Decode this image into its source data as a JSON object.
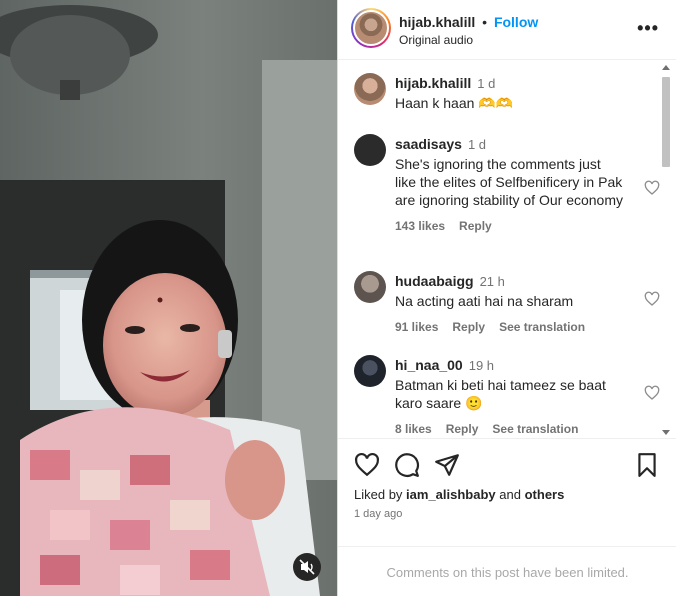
{
  "post": {
    "username": "hijab.khalill",
    "separator": "•",
    "follow_label": "Follow",
    "audio_label": "Original audio",
    "more_label": "•••"
  },
  "comments": [
    {
      "username": "hijab.khalill",
      "time": "1 d",
      "text": "Haan k haan 🫶🫶",
      "likes": "",
      "reply": "",
      "see_translation": "",
      "avatar_color": "#b88c72"
    },
    {
      "username": "saadisays",
      "time": "1 d",
      "text": "She's ignoring the comments just like the elites of Selfbenificery in Pak are ignoring stability of Our economy",
      "likes": "143 likes",
      "reply": "Reply",
      "see_translation": "",
      "avatar_color": "#2b2b2b"
    },
    {
      "username": "hudaabaigg",
      "time": "21 h",
      "text": "Na acting aati hai na sharam",
      "likes": "91 likes",
      "reply": "Reply",
      "see_translation": "See translation",
      "avatar_color": "#7a6f68"
    },
    {
      "username": "hi_naa_00",
      "time": "19 h",
      "text": "Batman ki beti hai tameez se baat karo saare 🙂",
      "likes": "8 likes",
      "reply": "Reply",
      "see_translation": "See translation",
      "avatar_color": "#2e3440"
    }
  ],
  "footer": {
    "liked_by_prefix": "Liked by",
    "liked_by_user": "iam_alishbaby",
    "liked_by_and": "and",
    "liked_by_others": "others",
    "date": "1 day ago",
    "limited_notice": "Comments on this post have been limited."
  },
  "icons": {
    "heart": "heart-icon",
    "comment": "comment-icon",
    "share": "share-icon",
    "save": "bookmark-icon",
    "mute": "muted-speaker-icon"
  },
  "colors": {
    "accent": "#0095f6",
    "muted_text": "#737373",
    "limited_text": "#a8a8a8",
    "border": "#dbdbdb"
  }
}
